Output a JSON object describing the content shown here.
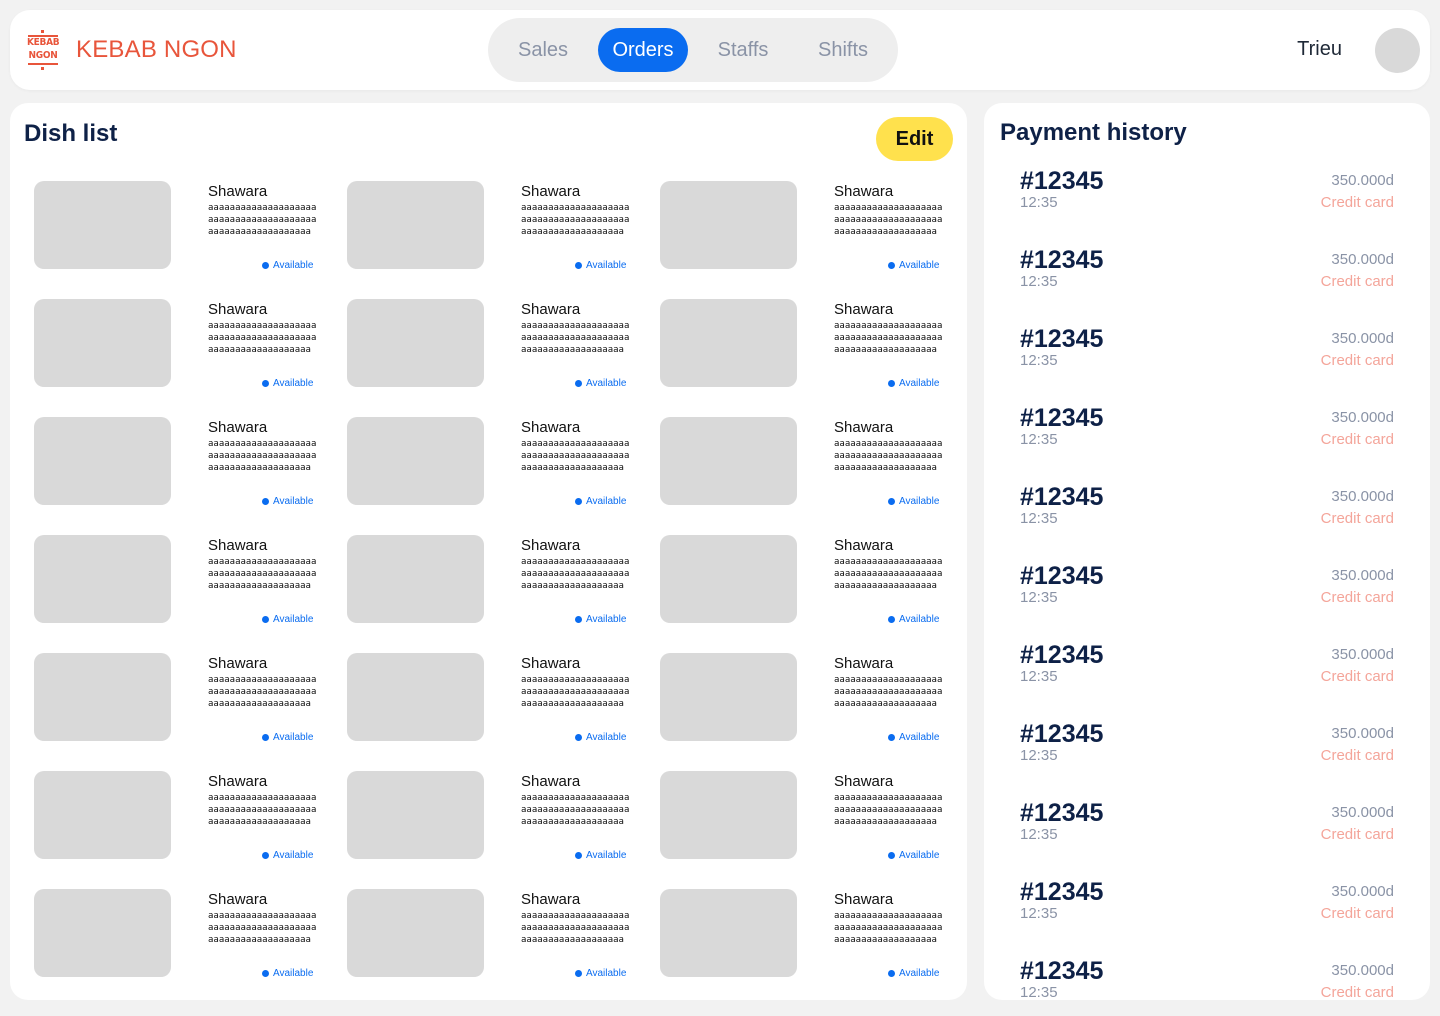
{
  "header": {
    "logo_line1": "KEBAB",
    "logo_line2": "NGON",
    "brand": "KEBAB NGON",
    "nav": [
      "Sales",
      "Orders",
      "Staffs",
      "Shifts"
    ],
    "active_nav": "Orders",
    "user_name": "Trieu"
  },
  "dishes": {
    "title": "Dish list",
    "edit_label": "Edit",
    "items": [
      {
        "name": "Shawara",
        "desc": "aaaaaaaaaaaaaaaaaaaaaaaaaaaaaaaaaaaaaaaaaaaaaaaaaaaaaaaaaaa",
        "status": "Available"
      },
      {
        "name": "Shawara",
        "desc": "aaaaaaaaaaaaaaaaaaaaaaaaaaaaaaaaaaaaaaaaaaaaaaaaaaaaaaaaaaa",
        "status": "Available"
      },
      {
        "name": "Shawara",
        "desc": "aaaaaaaaaaaaaaaaaaaaaaaaaaaaaaaaaaaaaaaaaaaaaaaaaaaaaaaaaaa",
        "status": "Available"
      },
      {
        "name": "Shawara",
        "desc": "aaaaaaaaaaaaaaaaaaaaaaaaaaaaaaaaaaaaaaaaaaaaaaaaaaaaaaaaaaa",
        "status": "Available"
      },
      {
        "name": "Shawara",
        "desc": "aaaaaaaaaaaaaaaaaaaaaaaaaaaaaaaaaaaaaaaaaaaaaaaaaaaaaaaaaaa",
        "status": "Available"
      },
      {
        "name": "Shawara",
        "desc": "aaaaaaaaaaaaaaaaaaaaaaaaaaaaaaaaaaaaaaaaaaaaaaaaaaaaaaaaaaa",
        "status": "Available"
      },
      {
        "name": "Shawara",
        "desc": "aaaaaaaaaaaaaaaaaaaaaaaaaaaaaaaaaaaaaaaaaaaaaaaaaaaaaaaaaaa",
        "status": "Available"
      },
      {
        "name": "Shawara",
        "desc": "aaaaaaaaaaaaaaaaaaaaaaaaaaaaaaaaaaaaaaaaaaaaaaaaaaaaaaaaaaa",
        "status": "Available"
      },
      {
        "name": "Shawara",
        "desc": "aaaaaaaaaaaaaaaaaaaaaaaaaaaaaaaaaaaaaaaaaaaaaaaaaaaaaaaaaaa",
        "status": "Available"
      },
      {
        "name": "Shawara",
        "desc": "aaaaaaaaaaaaaaaaaaaaaaaaaaaaaaaaaaaaaaaaaaaaaaaaaaaaaaaaaaa",
        "status": "Available"
      },
      {
        "name": "Shawara",
        "desc": "aaaaaaaaaaaaaaaaaaaaaaaaaaaaaaaaaaaaaaaaaaaaaaaaaaaaaaaaaaa",
        "status": "Available"
      },
      {
        "name": "Shawara",
        "desc": "aaaaaaaaaaaaaaaaaaaaaaaaaaaaaaaaaaaaaaaaaaaaaaaaaaaaaaaaaaa",
        "status": "Available"
      },
      {
        "name": "Shawara",
        "desc": "aaaaaaaaaaaaaaaaaaaaaaaaaaaaaaaaaaaaaaaaaaaaaaaaaaaaaaaaaaa",
        "status": "Available"
      },
      {
        "name": "Shawara",
        "desc": "aaaaaaaaaaaaaaaaaaaaaaaaaaaaaaaaaaaaaaaaaaaaaaaaaaaaaaaaaaa",
        "status": "Available"
      },
      {
        "name": "Shawara",
        "desc": "aaaaaaaaaaaaaaaaaaaaaaaaaaaaaaaaaaaaaaaaaaaaaaaaaaaaaaaaaaa",
        "status": "Available"
      },
      {
        "name": "Shawara",
        "desc": "aaaaaaaaaaaaaaaaaaaaaaaaaaaaaaaaaaaaaaaaaaaaaaaaaaaaaaaaaaa",
        "status": "Available"
      },
      {
        "name": "Shawara",
        "desc": "aaaaaaaaaaaaaaaaaaaaaaaaaaaaaaaaaaaaaaaaaaaaaaaaaaaaaaaaaaa",
        "status": "Available"
      },
      {
        "name": "Shawara",
        "desc": "aaaaaaaaaaaaaaaaaaaaaaaaaaaaaaaaaaaaaaaaaaaaaaaaaaaaaaaaaaa",
        "status": "Available"
      },
      {
        "name": "Shawara",
        "desc": "aaaaaaaaaaaaaaaaaaaaaaaaaaaaaaaaaaaaaaaaaaaaaaaaaaaaaaaaaaa",
        "status": "Available"
      },
      {
        "name": "Shawara",
        "desc": "aaaaaaaaaaaaaaaaaaaaaaaaaaaaaaaaaaaaaaaaaaaaaaaaaaaaaaaaaaa",
        "status": "Available"
      },
      {
        "name": "Shawara",
        "desc": "aaaaaaaaaaaaaaaaaaaaaaaaaaaaaaaaaaaaaaaaaaaaaaaaaaaaaaaaaaa",
        "status": "Available"
      }
    ]
  },
  "payments": {
    "title": "Payment history",
    "items": [
      {
        "id": "#12345",
        "time": "12:35",
        "amount": "350.000d",
        "method": "Credit card"
      },
      {
        "id": "#12345",
        "time": "12:35",
        "amount": "350.000d",
        "method": "Credit card"
      },
      {
        "id": "#12345",
        "time": "12:35",
        "amount": "350.000d",
        "method": "Credit card"
      },
      {
        "id": "#12345",
        "time": "12:35",
        "amount": "350.000d",
        "method": "Credit card"
      },
      {
        "id": "#12345",
        "time": "12:35",
        "amount": "350.000d",
        "method": "Credit card"
      },
      {
        "id": "#12345",
        "time": "12:35",
        "amount": "350.000d",
        "method": "Credit card"
      },
      {
        "id": "#12345",
        "time": "12:35",
        "amount": "350.000d",
        "method": "Credit card"
      },
      {
        "id": "#12345",
        "time": "12:35",
        "amount": "350.000d",
        "method": "Credit card"
      },
      {
        "id": "#12345",
        "time": "12:35",
        "amount": "350.000d",
        "method": "Credit card"
      },
      {
        "id": "#12345",
        "time": "12:35",
        "amount": "350.000d",
        "method": "Credit card"
      },
      {
        "id": "#12345",
        "time": "12:35",
        "amount": "350.000d",
        "method": "Credit card"
      }
    ]
  },
  "colors": {
    "brand": "#E8553B",
    "accent": "#0A6CF0",
    "edit_button": "#FFE14D",
    "title": "#0E2147",
    "payment_method": "#F4A59A"
  }
}
